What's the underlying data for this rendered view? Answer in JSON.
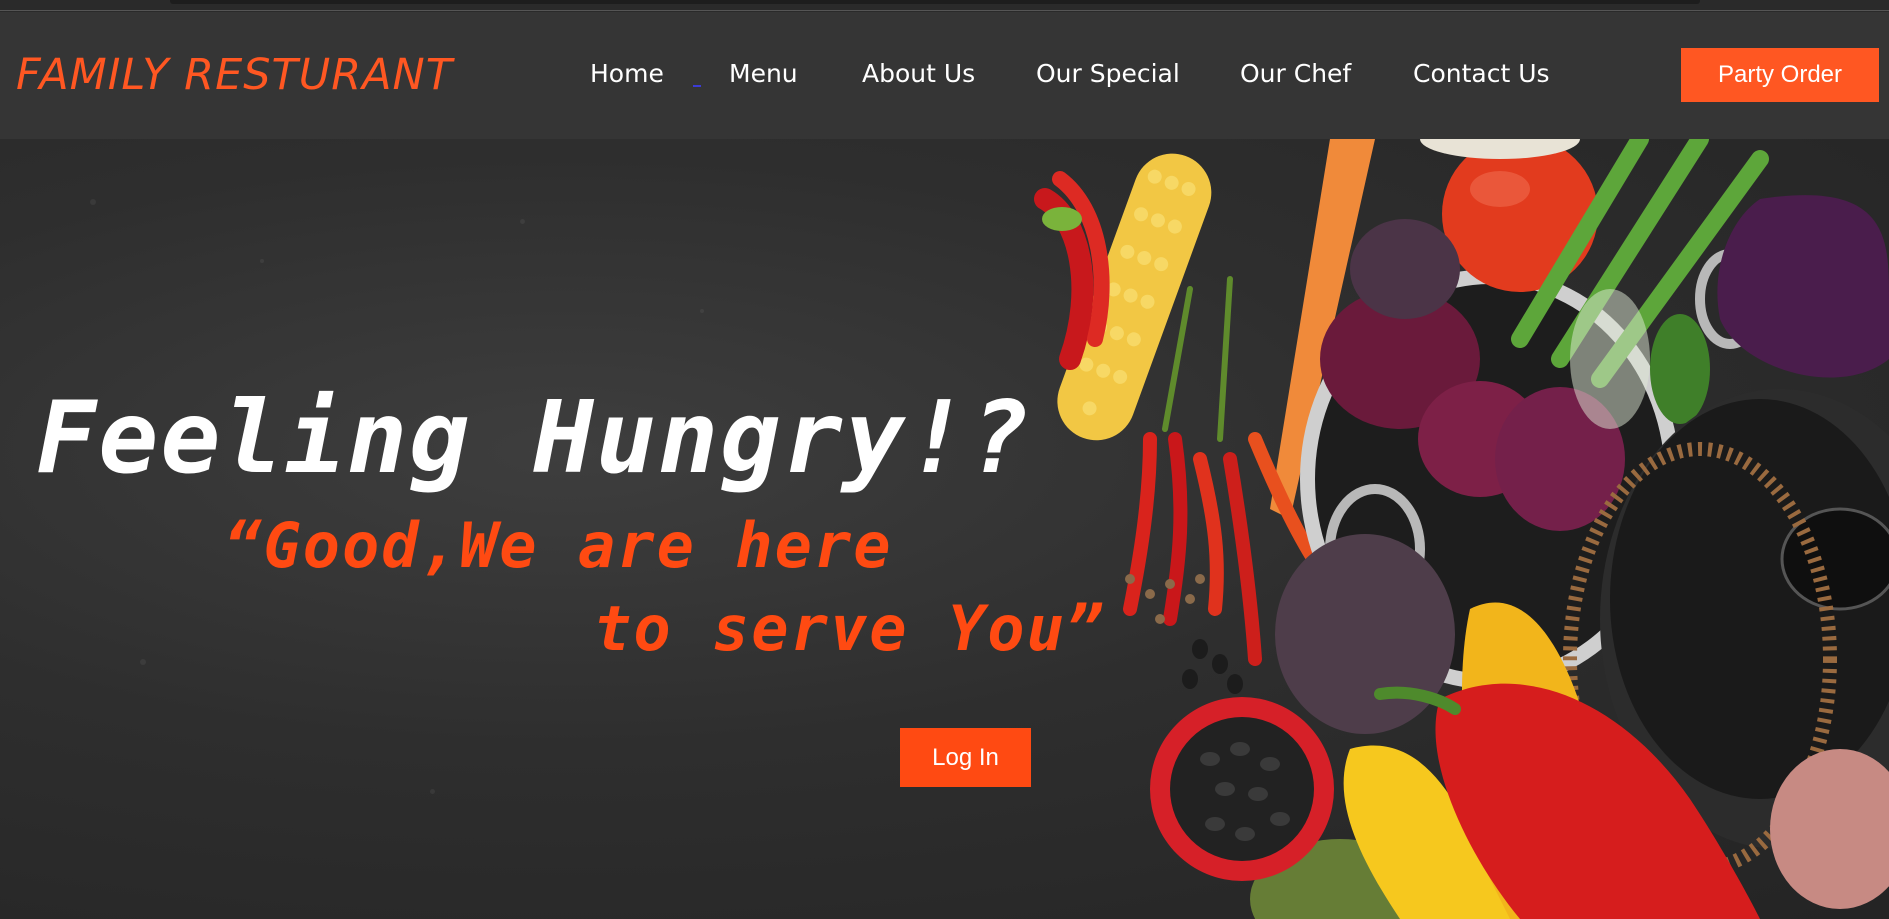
{
  "navbar": {
    "brand": "FAMILY RESTURANT",
    "links": [
      {
        "label": "Home"
      },
      {
        "label": "Menu"
      },
      {
        "label": "About Us"
      },
      {
        "label": "Our Special"
      },
      {
        "label": "Our Chef"
      },
      {
        "label": "Contact Us"
      }
    ],
    "party_order_label": "Party Order"
  },
  "hero": {
    "headline": "Feeling Hungry!?",
    "quote_line1": "“Good,We are here",
    "quote_line2": "to serve You”",
    "login_label": "Log In"
  },
  "colors": {
    "accent": "#ff5722",
    "nav_bg": "#353535",
    "hero_bg": "#2e2e2e",
    "text": "#ffffff"
  }
}
